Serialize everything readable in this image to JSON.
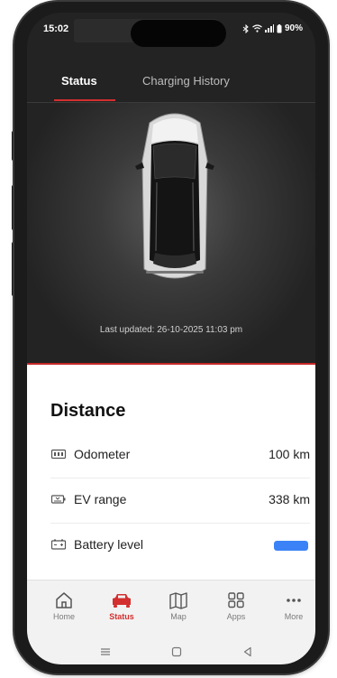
{
  "status_bar": {
    "time": "15:02",
    "battery_text": "90%"
  },
  "tabs": [
    {
      "label": "Status",
      "active": true
    },
    {
      "label": "Charging History",
      "active": false
    }
  ],
  "hero": {
    "last_updated": "Last updated: 26-10-2025 11:03 pm"
  },
  "distance": {
    "title": "Distance",
    "rows": [
      {
        "icon": "odometer-icon",
        "label": "Odometer",
        "value": "100 km"
      },
      {
        "icon": "ev-range-icon",
        "label": "EV range",
        "value": "338 km"
      },
      {
        "icon": "battery-icon",
        "label": "Battery level",
        "battery_fraction": 1.0
      }
    ]
  },
  "bottom_nav": [
    {
      "icon": "home-icon",
      "label": "Home",
      "active": false
    },
    {
      "icon": "car-icon",
      "label": "Status",
      "active": true
    },
    {
      "icon": "map-icon",
      "label": "Map",
      "active": false
    },
    {
      "icon": "apps-icon",
      "label": "Apps",
      "active": false
    },
    {
      "icon": "more-icon",
      "label": "More",
      "active": false
    }
  ],
  "colors": {
    "accent": "#d32f2f",
    "battery": "#3b82f6",
    "dark_bg": "#232323"
  }
}
